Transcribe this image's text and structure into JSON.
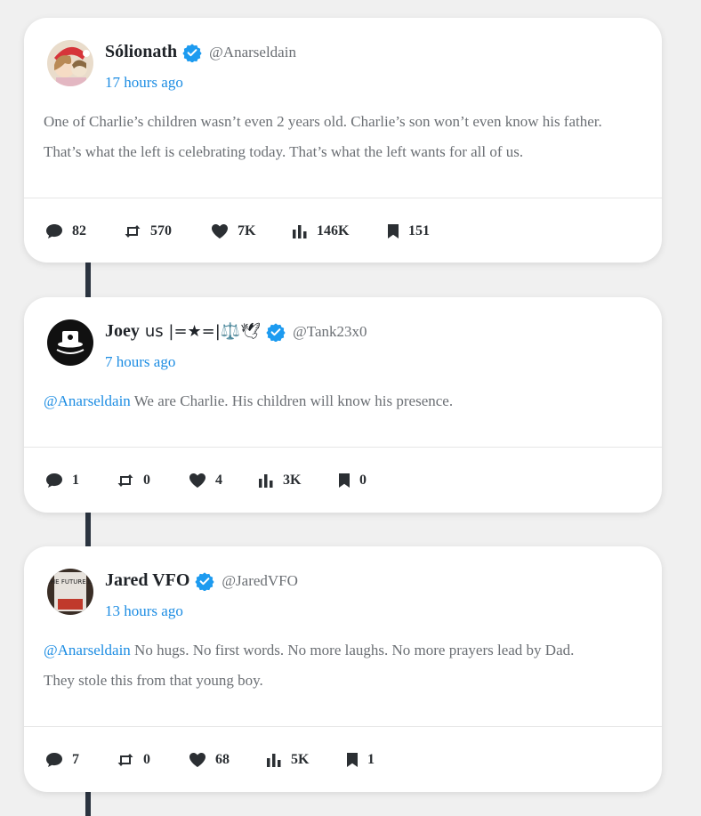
{
  "posts": [
    {
      "name": "Sólionath",
      "handle": "@Anarseldain",
      "time": "17 hours ago",
      "mention": "",
      "text_line1": "One of Charlie’s children wasn’t even 2 years old. Charlie’s son won’t even know his father.",
      "text_line2": "That’s what the left is celebrating today. That’s what the left wants for all of us.",
      "replies": "82",
      "reposts": "570",
      "likes": "7K",
      "views": "146K",
      "bookmarks": "151"
    },
    {
      "name": "Joey",
      "name_suffix": "us |=★=|⚖️🕊",
      "handle": "@Tank23x0",
      "time": "7 hours ago",
      "mention": "@Anarseldain",
      "text_line1": "We are Charlie. His children will know his presence.",
      "replies": "1",
      "reposts": "0",
      "likes": "4",
      "views": "3K",
      "bookmarks": "0"
    },
    {
      "name": "Jared VFO",
      "handle": "@JaredVFO",
      "time": "13 hours ago",
      "mention": "@Anarseldain",
      "text_line1": "No hugs. No first words. No more laughs. No more prayers lead by Dad.",
      "text_line2": "They stole this from that young boy.",
      "replies": "7",
      "reposts": "0",
      "likes": "68",
      "views": "5K",
      "bookmarks": "1",
      "avatar_text": "THE FUTURE IS"
    }
  ],
  "icons": {
    "reply": "comment-icon",
    "repost": "repost-icon",
    "like": "heart-icon",
    "views": "views-bar-icon",
    "bookmark": "bookmark-icon",
    "verified": "verified-badge-icon"
  },
  "colors": {
    "accent": "#1d8de3",
    "verified": "#1d9bf0",
    "connector": "#2b3440"
  }
}
